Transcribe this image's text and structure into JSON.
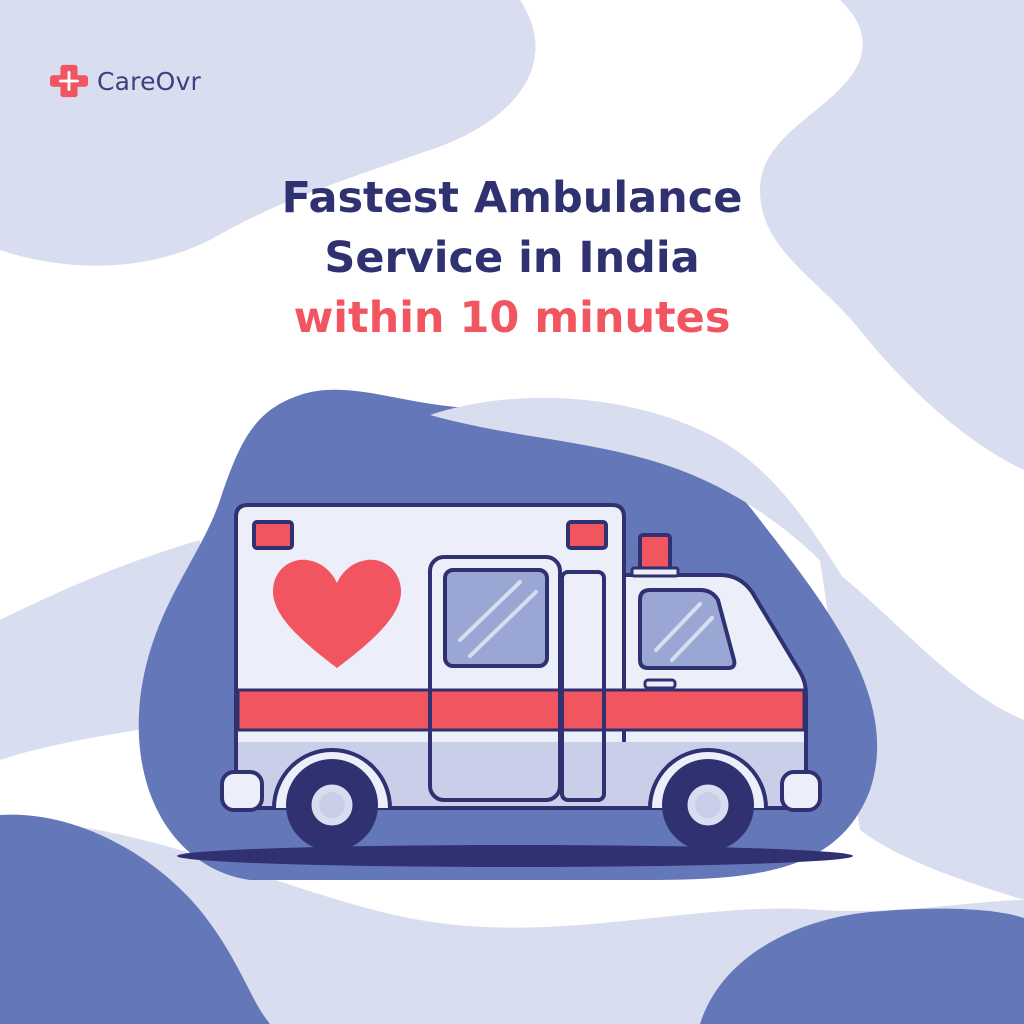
{
  "brand": {
    "name": "CareOvr",
    "icon": "medical-cross-icon"
  },
  "headline": {
    "line1": "Fastest Ambulance",
    "line2": "Service in India",
    "line3": "within 10 minutes"
  },
  "illustration": {
    "subject": "ambulance-icon",
    "emblem": "heart-icon"
  },
  "colors": {
    "navy": "#2f3170",
    "accent_red": "#f1555f",
    "blob_dark": "#6477b8",
    "blob_light": "#d8ddef"
  }
}
